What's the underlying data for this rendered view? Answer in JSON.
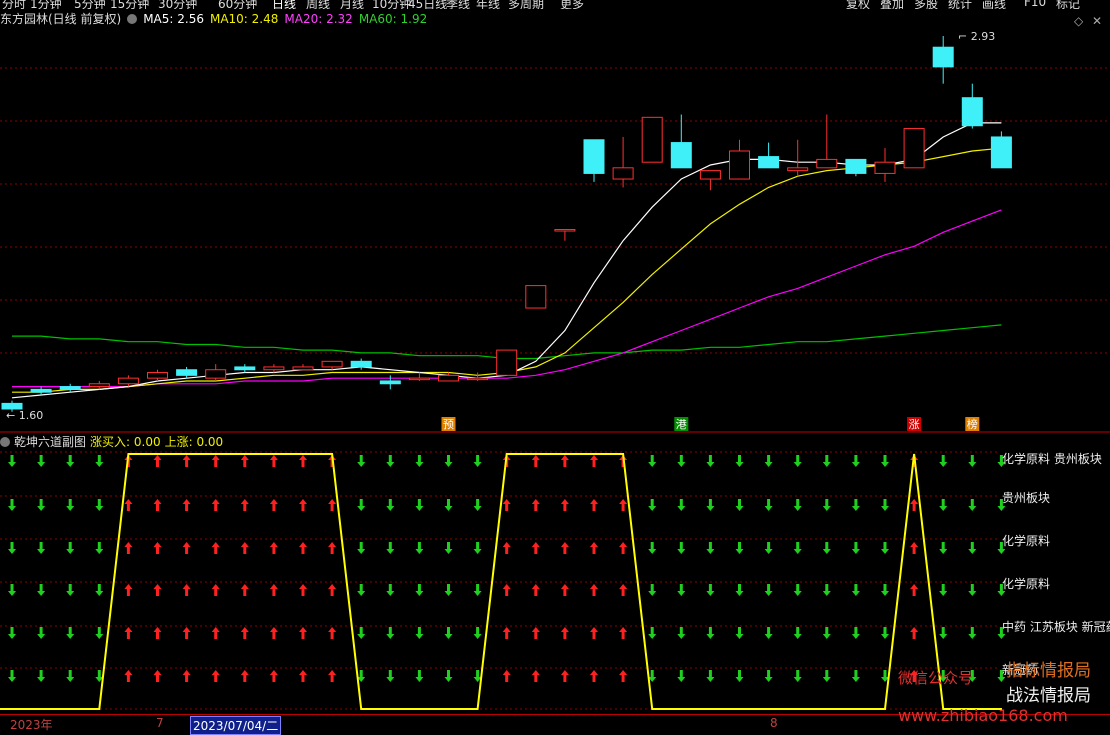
{
  "toolbar": {
    "periods": [
      "分时",
      "1分钟",
      "5分钟",
      "15分钟",
      "30分钟",
      "60分钟",
      "日线",
      "周线",
      "月线",
      "10分钟",
      "45日线",
      "季线",
      "年线",
      "多周期",
      "更多"
    ],
    "active_period": "日线",
    "right_buttons": [
      "复权",
      "叠加",
      "多股",
      "统计",
      "画线",
      "F10",
      "标记"
    ]
  },
  "header": {
    "stock_name": "东方园林(日线 前复权)",
    "ma5": "MA5: 2.56",
    "ma10": "MA10: 2.48",
    "ma20": "MA20: 2.32",
    "ma60": "MA60: 1.92",
    "icons": [
      "diamond-icon",
      "close-icon"
    ]
  },
  "colors": {
    "up": "#ff3030",
    "down": "#3ff0f8",
    "ma5": "#ffffff",
    "ma10": "#f0f000",
    "ma20": "#ff00ff",
    "ma60": "#00c000",
    "grid": "#8a0000",
    "signal_line": "#ffff00",
    "up_arrow": "#ff2020",
    "down_arrow": "#20d020"
  },
  "chart_data": {
    "type": "candlestick",
    "y_range": [
      1.5,
      3.0
    ],
    "high_label": "2.93",
    "low_label": "1.60",
    "candles": [
      {
        "o": 1.62,
        "c": 1.6,
        "h": 1.63,
        "l": 1.59
      },
      {
        "o": 1.67,
        "c": 1.66,
        "h": 1.68,
        "l": 1.65
      },
      {
        "o": 1.68,
        "c": 1.67,
        "h": 1.69,
        "l": 1.66
      },
      {
        "o": 1.68,
        "c": 1.69,
        "h": 1.7,
        "l": 1.67
      },
      {
        "o": 1.69,
        "c": 1.71,
        "h": 1.72,
        "l": 1.68
      },
      {
        "o": 1.71,
        "c": 1.73,
        "h": 1.74,
        "l": 1.7
      },
      {
        "o": 1.74,
        "c": 1.72,
        "h": 1.75,
        "l": 1.71
      },
      {
        "o": 1.71,
        "c": 1.74,
        "h": 1.76,
        "l": 1.7
      },
      {
        "o": 1.75,
        "c": 1.74,
        "h": 1.76,
        "l": 1.73
      },
      {
        "o": 1.74,
        "c": 1.75,
        "h": 1.76,
        "l": 1.73
      },
      {
        "o": 1.74,
        "c": 1.75,
        "h": 1.76,
        "l": 1.74
      },
      {
        "o": 1.75,
        "c": 1.77,
        "h": 1.77,
        "l": 1.74
      },
      {
        "o": 1.77,
        "c": 1.75,
        "h": 1.78,
        "l": 1.74
      },
      {
        "o": 1.7,
        "c": 1.69,
        "h": 1.72,
        "l": 1.67
      },
      {
        "o": 1.71,
        "c": 1.71,
        "h": 1.73,
        "l": 1.7
      },
      {
        "o": 1.7,
        "c": 1.72,
        "h": 1.73,
        "l": 1.7
      },
      {
        "o": 1.71,
        "c": 1.71,
        "h": 1.73,
        "l": 1.7
      },
      {
        "o": 1.72,
        "c": 1.81,
        "h": 1.81,
        "l": 1.72
      },
      {
        "o": 1.96,
        "c": 2.04,
        "h": 2.04,
        "l": 1.96
      },
      {
        "o": 2.24,
        "c": 2.24,
        "h": 2.24,
        "l": 2.2
      },
      {
        "o": 2.56,
        "c": 2.44,
        "h": 2.56,
        "l": 2.41
      },
      {
        "o": 2.42,
        "c": 2.46,
        "h": 2.57,
        "l": 2.39
      },
      {
        "o": 2.48,
        "c": 2.64,
        "h": 2.64,
        "l": 2.48
      },
      {
        "o": 2.55,
        "c": 2.46,
        "h": 2.65,
        "l": 2.46
      },
      {
        "o": 2.42,
        "c": 2.45,
        "h": 2.45,
        "l": 2.38
      },
      {
        "o": 2.42,
        "c": 2.52,
        "h": 2.56,
        "l": 2.42
      },
      {
        "o": 2.5,
        "c": 2.46,
        "h": 2.55,
        "l": 2.46
      },
      {
        "o": 2.45,
        "c": 2.46,
        "h": 2.56,
        "l": 2.43
      },
      {
        "o": 2.46,
        "c": 2.49,
        "h": 2.65,
        "l": 2.46
      },
      {
        "o": 2.49,
        "c": 2.44,
        "h": 2.49,
        "l": 2.43
      },
      {
        "o": 2.44,
        "c": 2.48,
        "h": 2.53,
        "l": 2.41
      },
      {
        "o": 2.46,
        "c": 2.6,
        "h": 2.6,
        "l": 2.46
      },
      {
        "o": 2.89,
        "c": 2.82,
        "h": 2.93,
        "l": 2.76
      },
      {
        "o": 2.71,
        "c": 2.61,
        "h": 2.76,
        "l": 2.6
      },
      {
        "o": 2.57,
        "c": 2.46,
        "h": 2.59,
        "l": 2.46
      }
    ],
    "ma5": [
      1.64,
      1.65,
      1.66,
      1.67,
      1.68,
      1.7,
      1.71,
      1.72,
      1.73,
      1.73,
      1.74,
      1.74,
      1.75,
      1.74,
      1.73,
      1.72,
      1.71,
      1.72,
      1.77,
      1.88,
      2.05,
      2.2,
      2.32,
      2.42,
      2.47,
      2.49,
      2.49,
      2.48,
      2.48,
      2.47,
      2.47,
      2.49,
      2.57,
      2.62,
      2.62
    ],
    "ma10": [
      1.66,
      1.66,
      1.67,
      1.67,
      1.68,
      1.69,
      1.7,
      1.7,
      1.71,
      1.72,
      1.72,
      1.73,
      1.73,
      1.73,
      1.73,
      1.73,
      1.72,
      1.73,
      1.75,
      1.8,
      1.89,
      1.98,
      2.08,
      2.17,
      2.26,
      2.33,
      2.39,
      2.43,
      2.45,
      2.46,
      2.47,
      2.48,
      2.5,
      2.52,
      2.53
    ],
    "ma20": [
      1.68,
      1.68,
      1.68,
      1.68,
      1.68,
      1.69,
      1.69,
      1.69,
      1.7,
      1.7,
      1.7,
      1.71,
      1.71,
      1.71,
      1.71,
      1.71,
      1.71,
      1.71,
      1.72,
      1.74,
      1.77,
      1.8,
      1.84,
      1.88,
      1.92,
      1.96,
      2.0,
      2.03,
      2.07,
      2.11,
      2.15,
      2.18,
      2.23,
      2.27,
      2.31
    ],
    "ma60": [
      1.86,
      1.86,
      1.85,
      1.85,
      1.84,
      1.84,
      1.83,
      1.83,
      1.82,
      1.82,
      1.81,
      1.81,
      1.8,
      1.8,
      1.79,
      1.79,
      1.79,
      1.78,
      1.78,
      1.79,
      1.8,
      1.8,
      1.81,
      1.81,
      1.82,
      1.82,
      1.83,
      1.84,
      1.84,
      1.85,
      1.86,
      1.87,
      1.88,
      1.89,
      1.9
    ],
    "markers": [
      {
        "index": 15,
        "label": "预",
        "color": "#e08000"
      },
      {
        "index": 23,
        "label": "港",
        "color": "#009000"
      },
      {
        "index": 31,
        "label": "涨",
        "color": "#d00000"
      },
      {
        "index": 33,
        "label": "榜",
        "color": "#e08000"
      }
    ]
  },
  "sub_chart": {
    "title": "乾坤六道副图",
    "buy_label": "涨买入: 0.00",
    "up_label": "上涨: 0.00",
    "signal": [
      0,
      0,
      0,
      0,
      1,
      1,
      1,
      1,
      1,
      1,
      1,
      1,
      0,
      0,
      0,
      0,
      0,
      1,
      1,
      1,
      1,
      1,
      0,
      0,
      0,
      0,
      0,
      0,
      0,
      0,
      0,
      1,
      0,
      0,
      0
    ],
    "rows": 6,
    "side_labels": [
      "化学原料 贵州板块",
      "贵州板块",
      "化学原料",
      "化学原料",
      "中药 江苏板块 新冠药",
      "新冠药"
    ]
  },
  "axis": {
    "year_label": "2023年",
    "month_7": "7",
    "cursor_date": "2023/07/04/二",
    "month_8": "8"
  },
  "watermark": {
    "line1": "微信公众号",
    "line2": "战法情报局",
    "line3": "www.zhibiao168.com",
    "line4": "指标情报局"
  }
}
